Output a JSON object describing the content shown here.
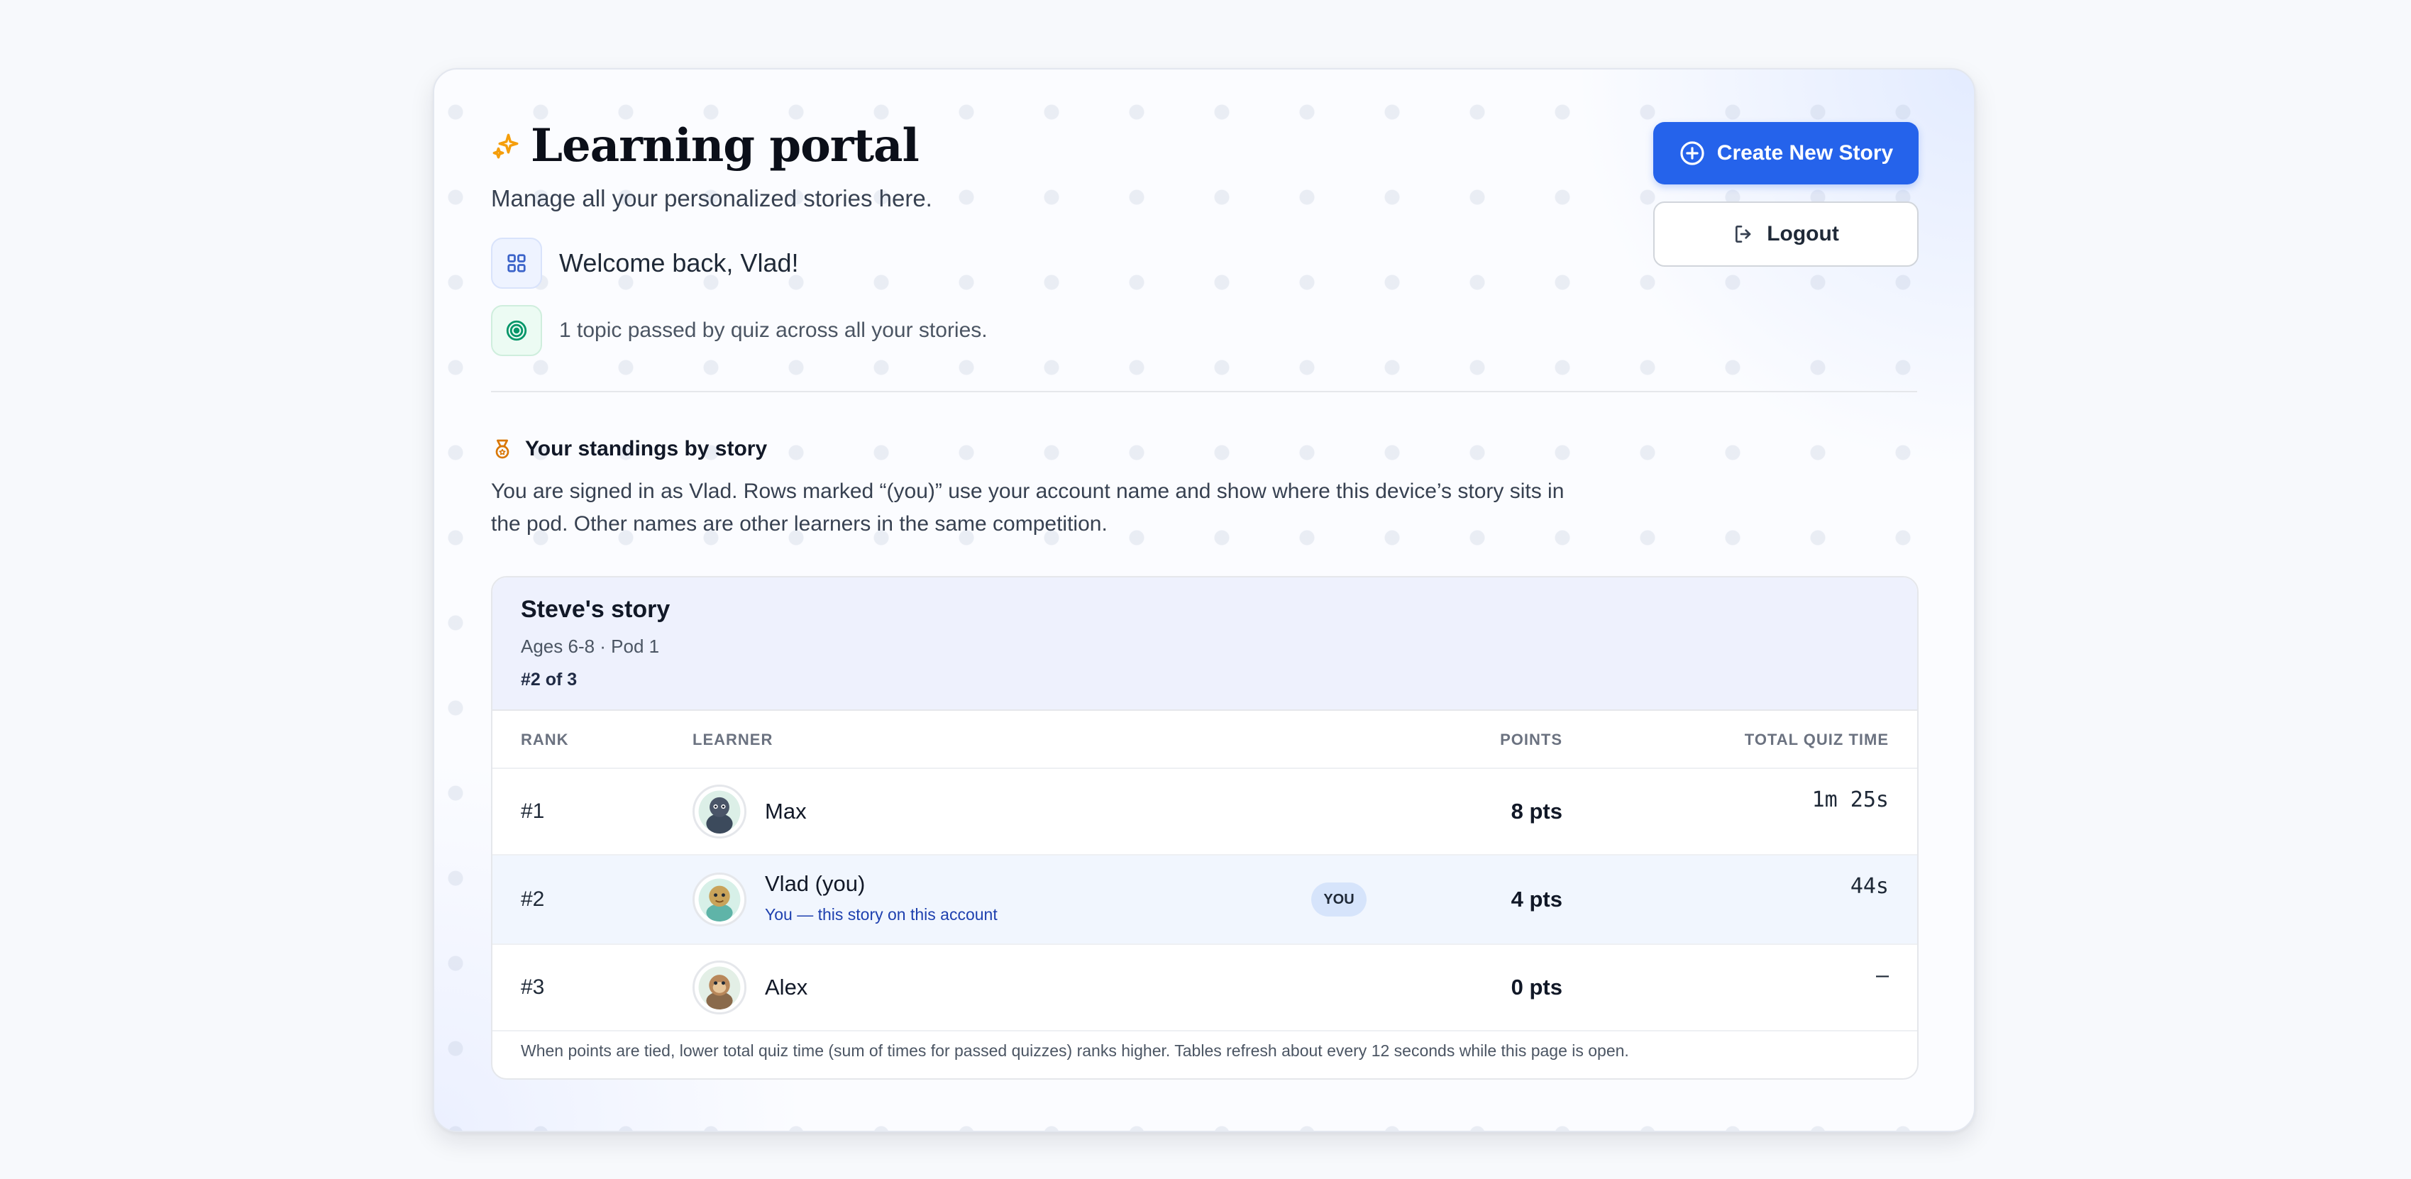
{
  "header": {
    "title": "Learning portal",
    "subtitle": "Manage all your personalized stories here.",
    "welcome": "Welcome back, Vlad!",
    "topics_passed": "1 topic passed by quiz across all your stories."
  },
  "actions": {
    "create_label": "Create New Story",
    "logout_label": "Logout"
  },
  "standings": {
    "heading": "Your standings by story",
    "description": "You are signed in as Vlad. Rows marked “(you)” use your account name and show where this device’s story sits in the pod. Other names are other learners in the same competition."
  },
  "story": {
    "title": "Steve's story",
    "meta": "Ages 6-8 · Pod 1",
    "rank": "#2 of 3",
    "columns": {
      "rank": "RANK",
      "learner": "LEARNER",
      "points": "POINTS",
      "time": "TOTAL QUIZ TIME"
    },
    "rows": [
      {
        "rank": "#1",
        "name": "Max",
        "points": "8 pts",
        "time": "1m 25s"
      },
      {
        "rank": "#2",
        "name": "Vlad (you)",
        "subtitle": "You — this story on this account",
        "badge": "YOU",
        "points": "4 pts",
        "time": "44s"
      },
      {
        "rank": "#3",
        "name": "Alex",
        "points": "0 pts",
        "time": "–"
      }
    ],
    "footnote": "When points are tied, lower total quiz time (sum of times for passed quizzes) ranks higher. Tables refresh about every 12 seconds while this page is open."
  },
  "colors": {
    "accent": "#2563eb",
    "you_row": "#f1f6fe",
    "badge": "#d6e4fb",
    "sparkle": "#f59e0b",
    "medal": "#d97706",
    "target": "#059669"
  }
}
